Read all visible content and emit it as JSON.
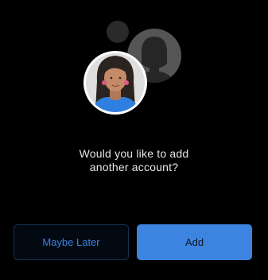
{
  "prompt": {
    "line1": "Would you like to add",
    "line2": "another account?"
  },
  "buttons": {
    "secondary_label": "Maybe Later",
    "primary_label": "Add"
  },
  "illustration": {
    "icons": [
      "small-dot-icon",
      "placeholder-person-avatar-icon",
      "woman-avatar-icon"
    ]
  },
  "colors": {
    "background": "#000000",
    "accent": "#3d84e1",
    "secondary_text": "#3c82dc",
    "prompt_text": "#e6e6e6"
  }
}
